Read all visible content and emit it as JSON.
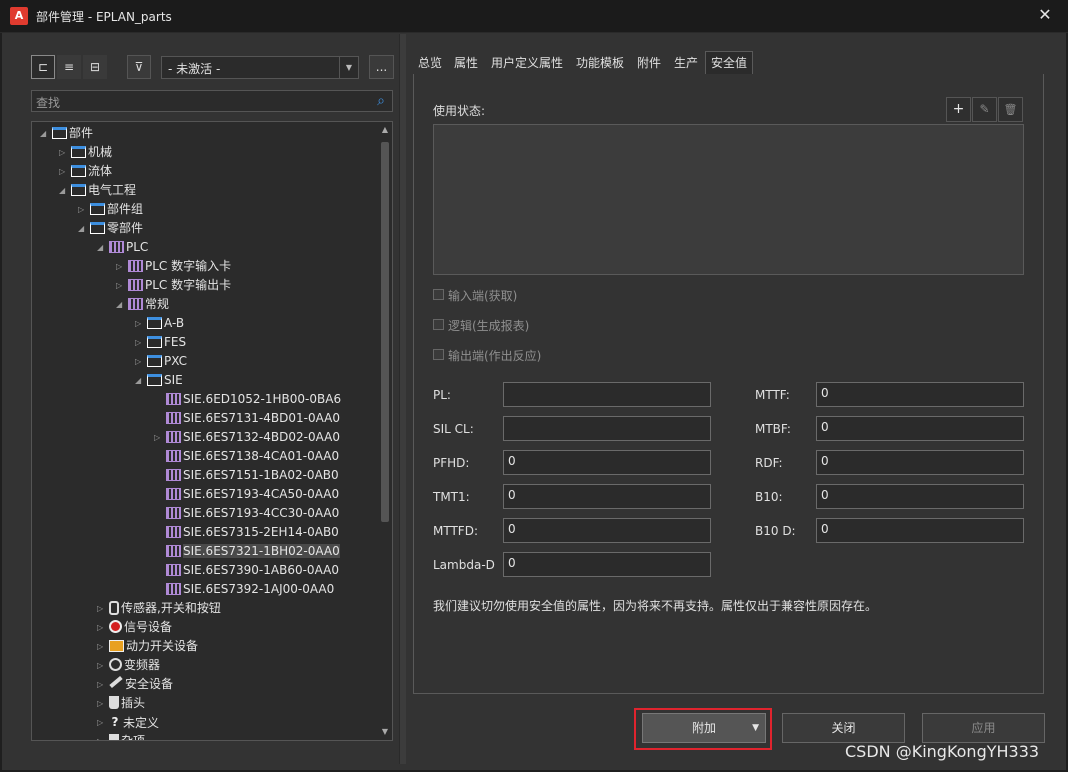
{
  "window": {
    "title": "部件管理 - EPLAN_parts",
    "close_glyph": "✕",
    "logo_glyph": "A"
  },
  "toolbar": {
    "tree_view_glyph": "⊏",
    "list_view_glyph": "≡",
    "detail_view_glyph": "⊟",
    "filter_glyph": "⊽",
    "filter_value": "- 未激活 -",
    "more_label": "..."
  },
  "search": {
    "placeholder": "查找"
  },
  "tree": {
    "nodes": [
      {
        "label": "部件",
        "icon": "folder"
      },
      {
        "label": "机械",
        "icon": "folder"
      },
      {
        "label": "流体",
        "icon": "folder"
      },
      {
        "label": "电气工程",
        "icon": "folder"
      },
      {
        "label": "部件组",
        "icon": "folder"
      },
      {
        "label": "零部件",
        "icon": "folder"
      },
      {
        "label": "PLC",
        "icon": "part"
      },
      {
        "label": "PLC 数字输入卡",
        "icon": "part"
      },
      {
        "label": "PLC 数字输出卡",
        "icon": "part"
      },
      {
        "label": "常规",
        "icon": "part"
      },
      {
        "label": "A-B",
        "icon": "folder"
      },
      {
        "label": "FES",
        "icon": "folder"
      },
      {
        "label": "PXC",
        "icon": "folder"
      },
      {
        "label": "SIE",
        "icon": "folder"
      },
      {
        "label": "SIE.6ED1052-1HB00-0BA6",
        "icon": "part"
      },
      {
        "label": "SIE.6ES7131-4BD01-0AA0",
        "icon": "part"
      },
      {
        "label": "SIE.6ES7132-4BD02-0AA0",
        "icon": "part"
      },
      {
        "label": "SIE.6ES7138-4CA01-0AA0",
        "icon": "part"
      },
      {
        "label": "SIE.6ES7151-1BA02-0AB0",
        "icon": "part"
      },
      {
        "label": "SIE.6ES7193-4CA50-0AA0",
        "icon": "part"
      },
      {
        "label": "SIE.6ES7193-4CC30-0AA0",
        "icon": "part"
      },
      {
        "label": "SIE.6ES7315-2EH14-0AB0",
        "icon": "part"
      },
      {
        "label": "SIE.6ES7321-1BH02-0AA0",
        "icon": "part"
      },
      {
        "label": "SIE.6ES7390-1AB60-0AA0",
        "icon": "part"
      },
      {
        "label": "SIE.6ES7392-1AJ00-0AA0",
        "icon": "part"
      },
      {
        "label": "传感器,开关和按钮",
        "icon": "sensor-icon"
      },
      {
        "label": "信号设备",
        "icon": "signal-icon"
      },
      {
        "label": "动力开关设备",
        "icon": "power-icon"
      },
      {
        "label": "变频器",
        "icon": "inverter-icon"
      },
      {
        "label": "安全设备",
        "icon": "safety-icon"
      },
      {
        "label": "插头",
        "icon": "plug-icon"
      },
      {
        "label": "未定义",
        "icon": "question-icon"
      },
      {
        "label": "杂项",
        "icon": "misc-icon"
      }
    ]
  },
  "tabs": [
    "总览",
    "属性",
    "用户定义属性",
    "功能模板",
    "附件",
    "生产",
    "安全值"
  ],
  "safety": {
    "usage_label": "使用状态:",
    "add_glyph": "+",
    "edit_glyph": "✎",
    "delete_glyph": "🗑",
    "checkboxes": [
      "输入端(获取)",
      "逻辑(生成报表)",
      "输出端(作出反应)"
    ],
    "fields": {
      "pl": {
        "label": "PL:",
        "value": ""
      },
      "silcl": {
        "label": "SIL CL:",
        "value": ""
      },
      "pfhd": {
        "label": "PFHD:",
        "value": "0"
      },
      "tmt1": {
        "label": "TMT1:",
        "value": "0"
      },
      "mttfd": {
        "label": "MTTFD:",
        "value": "0"
      },
      "lambda": {
        "label": "Lambda-D",
        "value": "0"
      },
      "mttf": {
        "label": "MTTF:",
        "value": "0"
      },
      "mtbf": {
        "label": "MTBF:",
        "value": "0"
      },
      "rdf": {
        "label": "RDF:",
        "value": "0"
      },
      "b10": {
        "label": "B10:",
        "value": "0"
      },
      "b10d": {
        "label": "B10 D:",
        "value": "0"
      }
    },
    "notice": "我们建议切勿使用安全值的属性，因为将来不再支持。属性仅出于兼容性原因存在。"
  },
  "buttons": {
    "attach": "附加",
    "attach_arrow": "▼",
    "close": "关闭",
    "apply": "应用"
  },
  "watermark": "CSDN @KingKongYH333",
  "colors": {
    "highlight": "#e0242e",
    "folder_accent": "#3d8fe0",
    "part_icon": "#b08ad6"
  }
}
